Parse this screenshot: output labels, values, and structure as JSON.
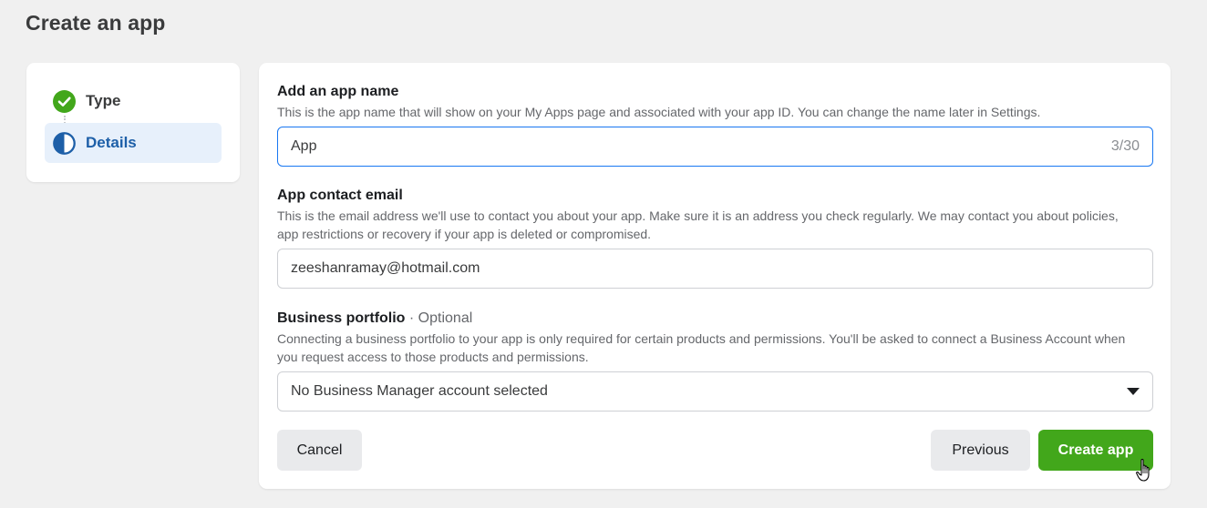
{
  "page": {
    "title": "Create an app"
  },
  "stepper": {
    "steps": [
      {
        "label": "Type",
        "state": "complete",
        "icon": "check-circle-icon"
      },
      {
        "label": "Details",
        "state": "current",
        "icon": "half-circle-icon"
      }
    ]
  },
  "form": {
    "app_name": {
      "label": "Add an app name",
      "help": "This is the app name that will show on your My Apps page and associated with your app ID. You can change the name later in Settings.",
      "value": "App",
      "counter": "3/30"
    },
    "contact_email": {
      "label": "App contact email",
      "help": "This is the email address we'll use to contact you about your app. Make sure it is an address you check regularly. We may contact you about policies, app restrictions or recovery if your app is deleted or compromised.",
      "value": "zeeshanramay@hotmail.com"
    },
    "business_portfolio": {
      "label": "Business portfolio",
      "optional": " · Optional",
      "help": "Connecting a business portfolio to your app is only required for certain products and permissions. You'll be asked to connect a Business Account when you request access to those products and permissions.",
      "selected": "No Business Manager account selected"
    }
  },
  "actions": {
    "cancel": "Cancel",
    "previous": "Previous",
    "create": "Create app"
  },
  "colors": {
    "accent": "#1877f2",
    "primary_button": "#42a71b",
    "complete_check": "#42a71b",
    "current_step_bg": "#e7f0fb"
  }
}
